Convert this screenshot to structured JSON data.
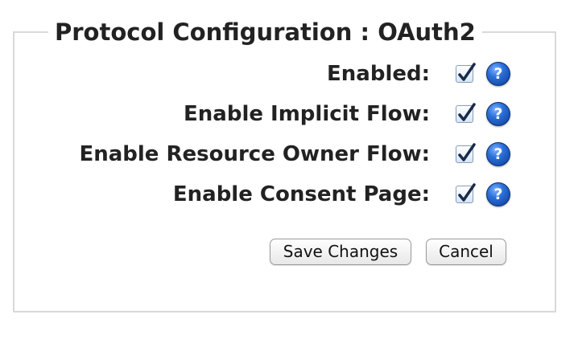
{
  "panel": {
    "legend": "Protocol Configuration : OAuth2"
  },
  "options": [
    {
      "label": "Enabled:",
      "checked": true,
      "help": "?"
    },
    {
      "label": "Enable Implicit Flow:",
      "checked": true,
      "help": "?"
    },
    {
      "label": "Enable Resource Owner Flow:",
      "checked": true,
      "help": "?"
    },
    {
      "label": "Enable Consent Page:",
      "checked": true,
      "help": "?"
    }
  ],
  "actions": {
    "save_label": "Save Changes",
    "cancel_label": "Cancel"
  },
  "icons": {
    "check": "checkmark-icon",
    "help": "help-icon"
  },
  "colors": {
    "checkmark": "#1a2a4a",
    "help_blue": "#1f5fc9"
  }
}
